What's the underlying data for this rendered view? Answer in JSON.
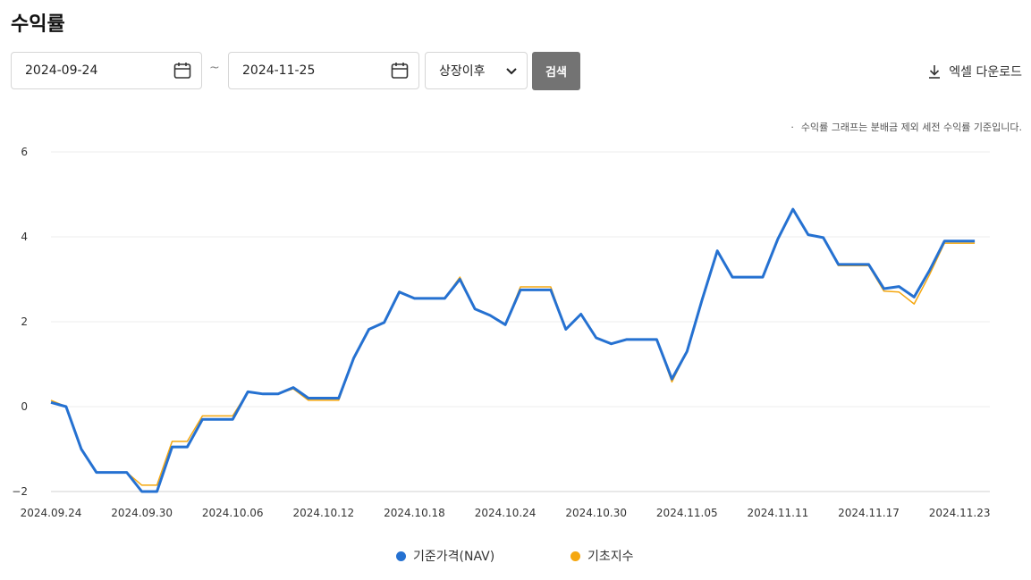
{
  "page": {
    "title": "수익률"
  },
  "filters": {
    "start_date": "2024-09-24",
    "end_date": "2024-11-25",
    "separator": "~",
    "period_select": "상장이후",
    "search_label": "검색",
    "excel_label": "엑셀 다운로드"
  },
  "note": {
    "bullet": "·",
    "text": "수익률 그래프는 분배금 제외 세전 수익률 기준입니다."
  },
  "icons": {
    "calendar": "calendar-icon",
    "chevron": "chevron-down-icon",
    "download": "download-icon"
  },
  "colors": {
    "nav": "#2571d1",
    "index": "#f5a70f",
    "search_bg": "#737373"
  },
  "chart_data": {
    "type": "line",
    "x": [
      "2024.09.24",
      "2024.09.25",
      "2024.09.26",
      "2024.09.27",
      "2024.09.28",
      "2024.09.29",
      "2024.09.30",
      "2024.10.01",
      "2024.10.02",
      "2024.10.03",
      "2024.10.04",
      "2024.10.05",
      "2024.10.06",
      "2024.10.07",
      "2024.10.08",
      "2024.10.09",
      "2024.10.10",
      "2024.10.11",
      "2024.10.12",
      "2024.10.13",
      "2024.10.14",
      "2024.10.15",
      "2024.10.16",
      "2024.10.17",
      "2024.10.18",
      "2024.10.19",
      "2024.10.20",
      "2024.10.21",
      "2024.10.22",
      "2024.10.23",
      "2024.10.24",
      "2024.10.25",
      "2024.10.26",
      "2024.10.27",
      "2024.10.28",
      "2024.10.29",
      "2024.10.30",
      "2024.10.31",
      "2024.11.01",
      "2024.11.02",
      "2024.11.03",
      "2024.11.04",
      "2024.11.05",
      "2024.11.06",
      "2024.11.07",
      "2024.11.08",
      "2024.11.09",
      "2024.11.10",
      "2024.11.11",
      "2024.11.12",
      "2024.11.13",
      "2024.11.14",
      "2024.11.15",
      "2024.11.16",
      "2024.11.17",
      "2024.11.18",
      "2024.11.19",
      "2024.11.20",
      "2024.11.21",
      "2024.11.22",
      "2024.11.23",
      "2024.11.24",
      "2024.11.25"
    ],
    "series": [
      {
        "name": "기준가격(NAV)",
        "color": "#2571d1",
        "values": [
          0.1,
          0.0,
          -1.0,
          -1.55,
          -1.55,
          -1.55,
          -2.0,
          -2.0,
          -0.95,
          -0.95,
          -0.3,
          -0.3,
          -0.3,
          0.35,
          0.3,
          0.3,
          0.45,
          0.2,
          0.2,
          0.2,
          1.15,
          1.82,
          1.98,
          2.7,
          2.55,
          2.55,
          2.55,
          3.0,
          2.3,
          2.15,
          1.93,
          2.75,
          2.75,
          2.75,
          1.82,
          2.18,
          1.62,
          1.48,
          1.58,
          1.58,
          1.58,
          0.65,
          1.3,
          2.52,
          3.67,
          3.05,
          3.05,
          3.05,
          3.95,
          4.65,
          4.05,
          3.98,
          3.35,
          3.35,
          3.35,
          2.78,
          2.83,
          2.58,
          3.2,
          3.9,
          3.9,
          3.9
        ]
      },
      {
        "name": "기초지수",
        "color": "#f5a70f",
        "values": [
          0.15,
          0.0,
          -1.0,
          -1.55,
          -1.55,
          -1.55,
          -1.85,
          -1.85,
          -0.82,
          -0.82,
          -0.22,
          -0.22,
          -0.22,
          0.35,
          0.3,
          0.3,
          0.42,
          0.15,
          0.15,
          0.15,
          1.15,
          1.82,
          1.98,
          2.72,
          2.55,
          2.55,
          2.55,
          3.05,
          2.3,
          2.15,
          1.93,
          2.82,
          2.82,
          2.82,
          1.82,
          2.18,
          1.62,
          1.48,
          1.58,
          1.58,
          1.58,
          0.58,
          1.3,
          2.52,
          3.67,
          3.05,
          3.05,
          3.05,
          3.95,
          4.65,
          4.05,
          3.98,
          3.32,
          3.32,
          3.32,
          2.72,
          2.7,
          2.42,
          3.1,
          3.85,
          3.85,
          3.85
        ]
      }
    ],
    "y_ticks": [
      -2,
      0,
      2,
      4,
      6
    ],
    "y_tick_labels": [
      "−2",
      "0",
      "2",
      "4",
      "6"
    ],
    "x_tick_labels": [
      "2024.09.24",
      "2024.09.30",
      "2024.10.06",
      "2024.10.12",
      "2024.10.18",
      "2024.10.24",
      "2024.10.30",
      "2024.11.05",
      "2024.11.11",
      "2024.11.17",
      "2024.11.23"
    ],
    "ylim": [
      -2,
      6
    ],
    "grid": true,
    "legend": "bottom-center"
  }
}
